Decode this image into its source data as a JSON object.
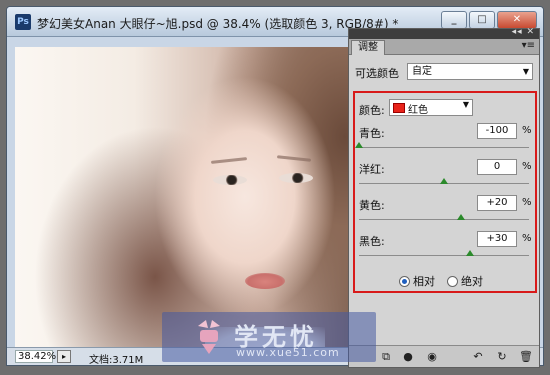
{
  "window": {
    "app_badge": "Ps",
    "title": "梦幻美女Anan 大眼仔~旭.psd @ 38.4% (选取颜色 3, RGB/8#) *",
    "buttons": {
      "minimize": "_",
      "restore": "□",
      "close": "✕"
    }
  },
  "status_bar": {
    "zoom": "38.42%",
    "doc_size": "文档:3.71M"
  },
  "panel": {
    "strip_glyph": "◂◂ ✕",
    "tab": "调整",
    "menu_glyph": "▾≡",
    "preset": {
      "label": "可选颜色",
      "value": "自定"
    },
    "colors": {
      "label": "颜色:",
      "value": "红色",
      "swatch": "#e8231a"
    },
    "sliders": [
      {
        "label": "青色:",
        "value": "-100",
        "unit": "%",
        "percent": -100
      },
      {
        "label": "洋红:",
        "value": "0",
        "unit": "%",
        "percent": 0
      },
      {
        "label": "黄色:",
        "value": "+20",
        "unit": "%",
        "percent": 20
      },
      {
        "label": "黑色:",
        "value": "+30",
        "unit": "%",
        "percent": 30
      }
    ],
    "method": {
      "relative": "相对",
      "absolute": "绝对",
      "selected": "relative"
    },
    "footer_icons": [
      "clip-icon",
      "visibility-icon",
      "eye-icon",
      "previous-state-icon",
      "reset-icon",
      "delete-icon"
    ]
  },
  "watermark": {
    "text": "学无忧",
    "url": "www.xue51.com"
  },
  "colors": {
    "highlight_border": "#d81a1a",
    "slider_thumb": "#2b8a2b"
  }
}
